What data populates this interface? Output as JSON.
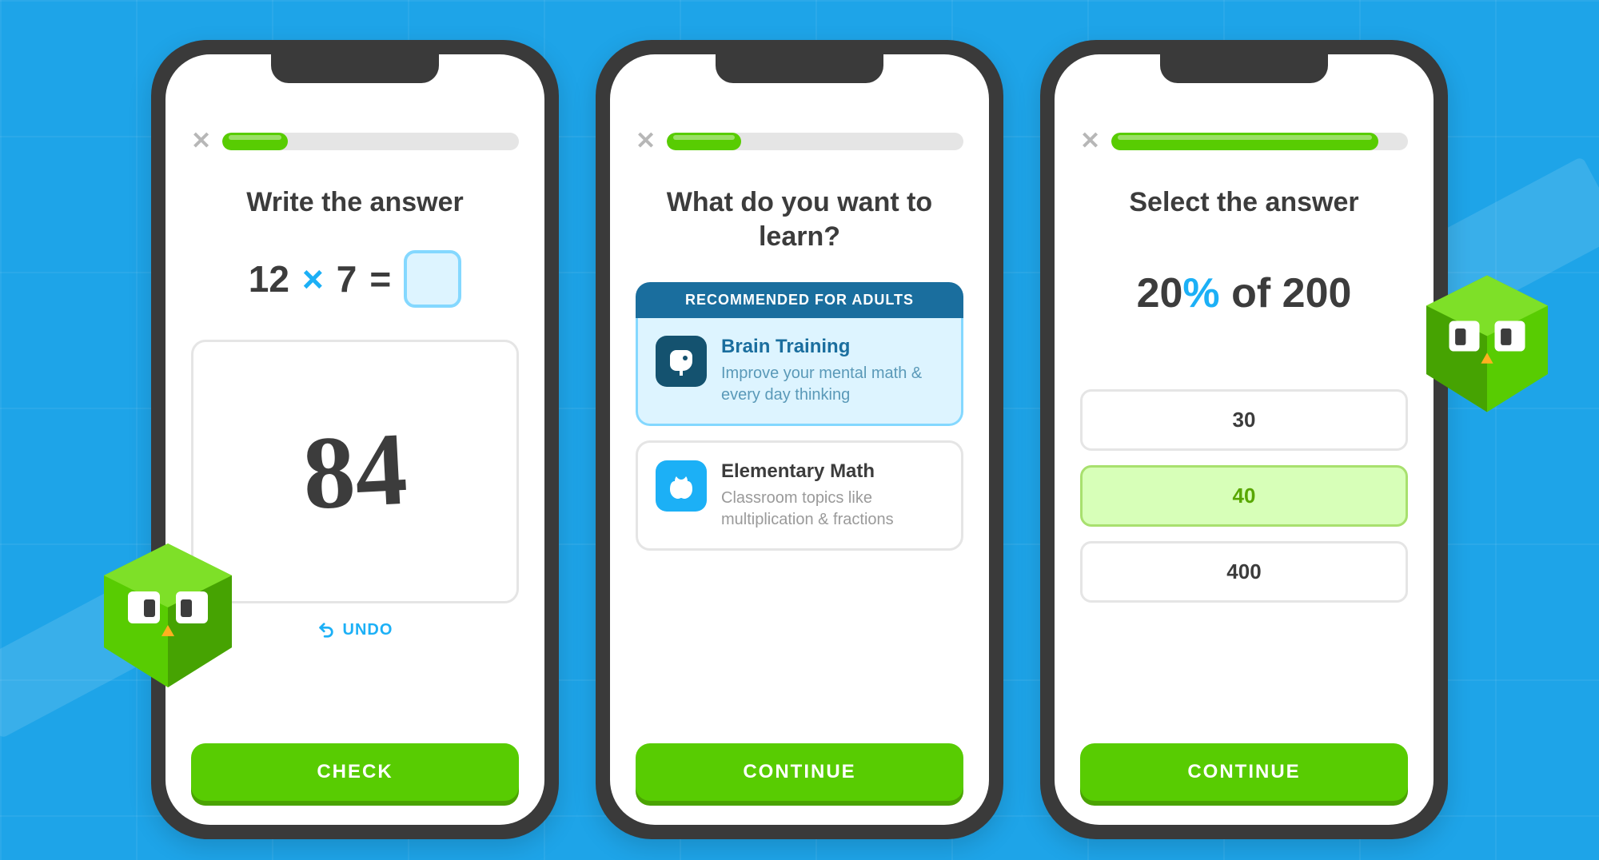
{
  "phone1": {
    "progress_pct": 22,
    "prompt": "Write the answer",
    "equation": {
      "a": "12",
      "op": "×",
      "b": "7",
      "eq": "="
    },
    "scratch_value": "84",
    "undo_label": "UNDO",
    "cta": "CHECK"
  },
  "phone2": {
    "progress_pct": 25,
    "prompt": "What do you want to learn?",
    "rec_banner": "RECOMMENDED FOR ADULTS",
    "cards": [
      {
        "title": "Brain Training",
        "desc": "Improve your mental math & every day thinking"
      },
      {
        "title": "Elementary Math",
        "desc": "Classroom topics like multiplication & fractions"
      }
    ],
    "cta": "CONTINUE"
  },
  "phone3": {
    "progress_pct": 90,
    "prompt": "Select the answer",
    "expr": {
      "n": "20",
      "pct": "%",
      "of": " of ",
      "m": "200"
    },
    "answers": [
      "30",
      "40",
      "400"
    ],
    "selected_index": 1,
    "cta": "CONTINUE"
  }
}
